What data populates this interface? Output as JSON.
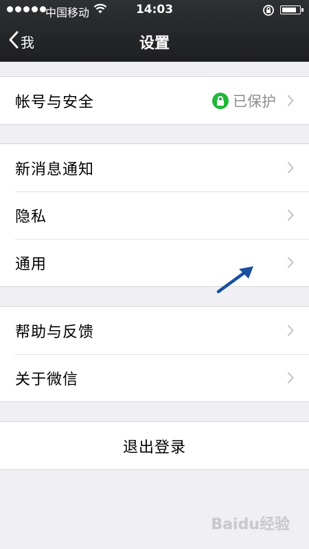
{
  "status_bar": {
    "carrier": "中国移动",
    "time": "14:03"
  },
  "nav": {
    "back_label": "我",
    "title": "设置"
  },
  "groups": [
    {
      "items": [
        {
          "label": "帐号与安全",
          "status": "已保护",
          "status_icon": "lock-icon",
          "status_color": "#20b73a"
        }
      ]
    },
    {
      "items": [
        {
          "label": "新消息通知"
        },
        {
          "label": "隐私"
        },
        {
          "label": "通用"
        }
      ]
    },
    {
      "items": [
        {
          "label": "帮助与反馈"
        },
        {
          "label": "关于微信"
        }
      ]
    }
  ],
  "logout": {
    "label": "退出登录"
  },
  "watermark": "Baidu经验",
  "colors": {
    "nav_background": "#2f3033",
    "page_background": "#efeff4",
    "protected_green": "#20b73a",
    "chevron_gray": "#c7c7cc",
    "annotation_arrow": "#1a4fa0"
  }
}
